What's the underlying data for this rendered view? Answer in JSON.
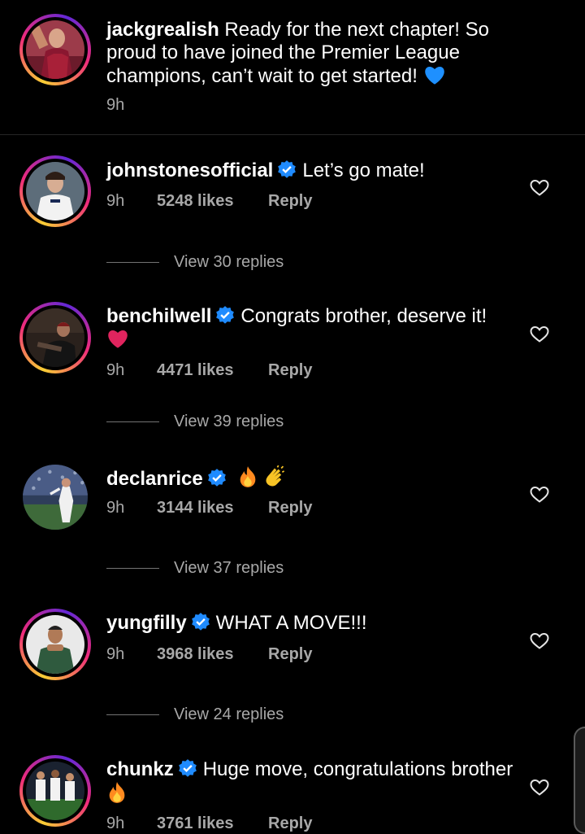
{
  "post": {
    "username": "jackgrealish",
    "caption": "Ready for the next chapter! So proud to have joined the Premier League champions, can’t wait to get started!",
    "emoji": "blue-heart",
    "time": "9h"
  },
  "comments": [
    {
      "username": "johnstonesofficial",
      "text": "Let’s go mate!",
      "time": "9h",
      "likes": "5248 likes",
      "reply": "Reply",
      "view_replies": "View 30 replies"
    },
    {
      "username": "benchilwell",
      "text": "Congrats brother, deserve it!",
      "time": "9h",
      "likes": "4471 likes",
      "reply": "Reply",
      "view_replies": "View 39 replies"
    },
    {
      "username": "declanrice",
      "text": "",
      "time": "9h",
      "likes": "3144 likes",
      "reply": "Reply",
      "view_replies": "View 37 replies"
    },
    {
      "username": "yungfilly",
      "text": "WHAT A MOVE!!!",
      "time": "9h",
      "likes": "3968 likes",
      "reply": "Reply",
      "view_replies": "View 24 replies"
    },
    {
      "username": "chunkz",
      "text": "Huge move, congratulations brother",
      "time": "9h",
      "likes": "3761 likes",
      "reply": "Reply"
    }
  ],
  "colors": {
    "background": "#000000",
    "verified": "#1f8bff",
    "meta": "#a8a8a8",
    "heart_red": "#e0245e",
    "heart_blue": "#1e90ff"
  }
}
